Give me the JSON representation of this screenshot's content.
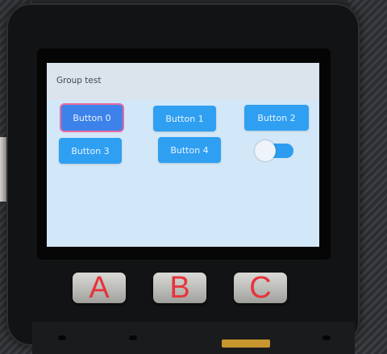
{
  "screen": {
    "title": "Group test",
    "buttons": [
      {
        "label": "Button 0",
        "focused": true
      },
      {
        "label": "Button 1",
        "focused": false
      },
      {
        "label": "Button 2",
        "focused": false
      },
      {
        "label": "Button 3",
        "focused": false
      },
      {
        "label": "Button 4",
        "focused": false
      }
    ],
    "switch": {
      "state": "on"
    }
  },
  "hardware_buttons": [
    {
      "label": "A"
    },
    {
      "label": "B"
    },
    {
      "label": "C"
    }
  ],
  "colors": {
    "screen_background": "#d2e7f8",
    "button_blue": "#2f9ff2",
    "focus_outline": "#ea6aa0",
    "hardware_label": "#e8333a"
  }
}
